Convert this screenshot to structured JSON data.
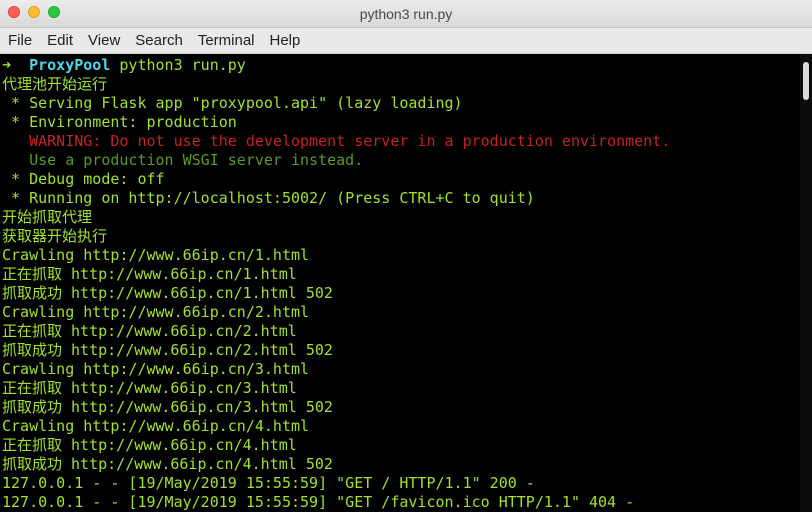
{
  "window": {
    "title": "python3 run.py"
  },
  "menu": {
    "items": [
      "File",
      "Edit",
      "View",
      "Search",
      "Terminal",
      "Help"
    ]
  },
  "terminal": {
    "prompt": {
      "arrow": "➜",
      "directory": "ProxyPool",
      "command": "python3 run.py"
    },
    "lines": [
      {
        "text": "代理池开始运行",
        "style": "normal"
      },
      {
        "text": " * Serving Flask app \"proxypool.api\" (lazy loading)",
        "style": "normal"
      },
      {
        "text": " * Environment: production",
        "style": "normal"
      },
      {
        "text": "   WARNING: Do not use the development server in a production environment.",
        "style": "warn"
      },
      {
        "text": "   Use a production WSGI server instead.",
        "style": "dim"
      },
      {
        "text": " * Debug mode: off",
        "style": "normal"
      },
      {
        "text": " * Running on http://localhost:5002/ (Press CTRL+C to quit)",
        "style": "normal"
      },
      {
        "text": "开始抓取代理",
        "style": "normal"
      },
      {
        "text": "获取器开始执行",
        "style": "normal"
      },
      {
        "text": "Crawling http://www.66ip.cn/1.html",
        "style": "normal"
      },
      {
        "text": "正在抓取 http://www.66ip.cn/1.html",
        "style": "normal"
      },
      {
        "text": "抓取成功 http://www.66ip.cn/1.html 502",
        "style": "normal"
      },
      {
        "text": "Crawling http://www.66ip.cn/2.html",
        "style": "normal"
      },
      {
        "text": "正在抓取 http://www.66ip.cn/2.html",
        "style": "normal"
      },
      {
        "text": "抓取成功 http://www.66ip.cn/2.html 502",
        "style": "normal"
      },
      {
        "text": "Crawling http://www.66ip.cn/3.html",
        "style": "normal"
      },
      {
        "text": "正在抓取 http://www.66ip.cn/3.html",
        "style": "normal"
      },
      {
        "text": "抓取成功 http://www.66ip.cn/3.html 502",
        "style": "normal"
      },
      {
        "text": "Crawling http://www.66ip.cn/4.html",
        "style": "normal"
      },
      {
        "text": "正在抓取 http://www.66ip.cn/4.html",
        "style": "normal"
      },
      {
        "text": "抓取成功 http://www.66ip.cn/4.html 502",
        "style": "normal"
      },
      {
        "text": "127.0.0.1 - - [19/May/2019 15:55:59] \"GET / HTTP/1.1\" 200 -",
        "style": "normal"
      },
      {
        "text": "127.0.0.1 - - [19/May/2019 15:55:59] \"GET /favicon.ico HTTP/1.1\" 404 -",
        "style": "normal"
      }
    ]
  },
  "colors": {
    "output_green": "#a2e22a",
    "prompt_cyan": "#4ed7e8",
    "warning_red": "#c62020",
    "background": "#000000"
  }
}
